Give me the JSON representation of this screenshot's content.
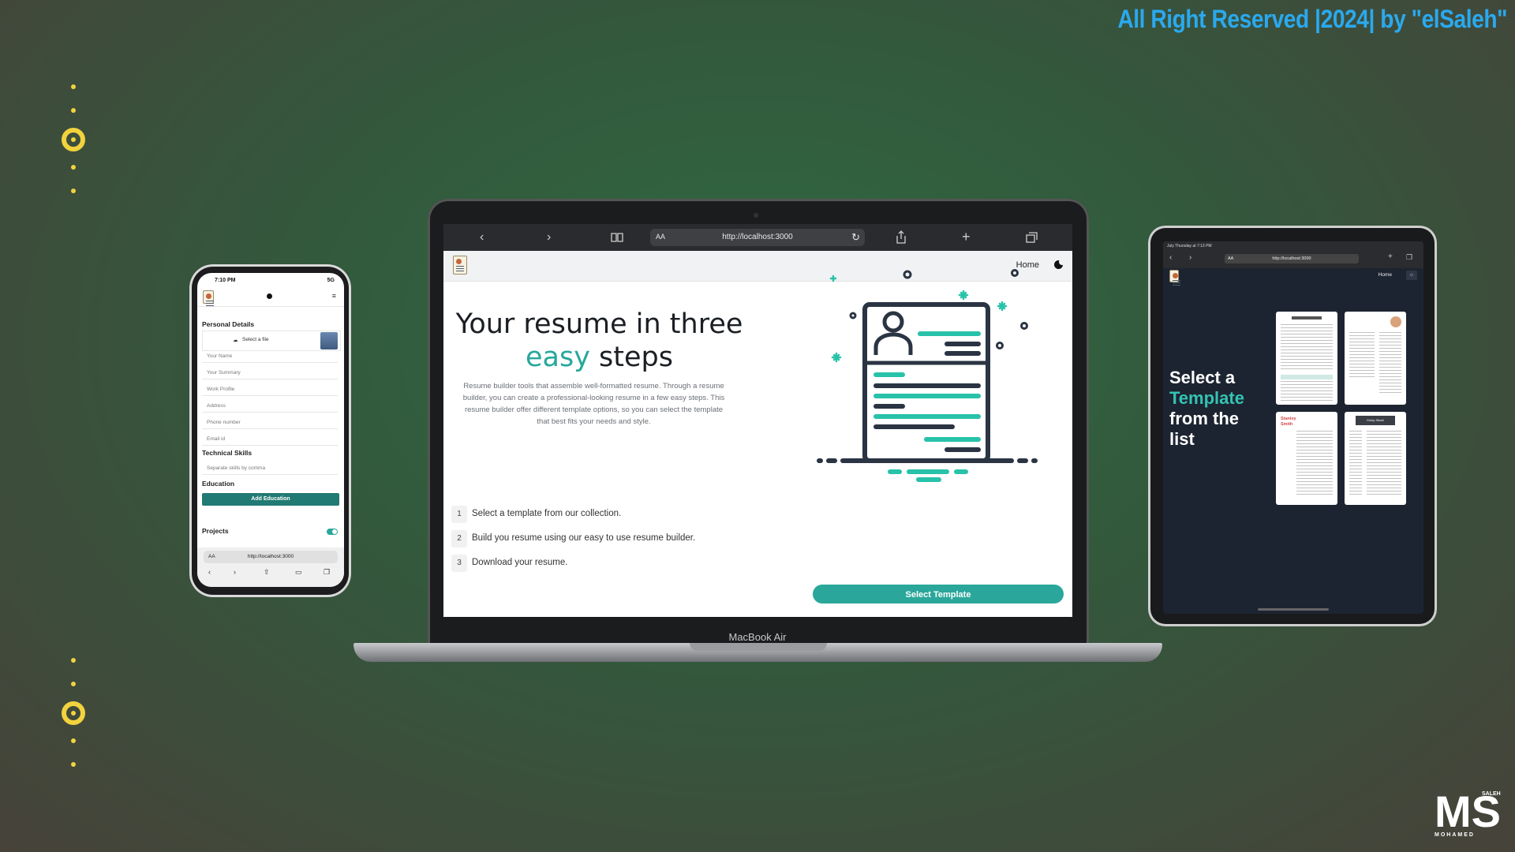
{
  "copyright": "All Right Reserved |2024| by \"elSaleh\"",
  "signature": {
    "letters": "MS",
    "top": "SALEH",
    "bottom": "MOHAMED"
  },
  "laptop": {
    "device_label": "MacBook Air",
    "browser": {
      "aa": "AA",
      "url": "http://localhost:3000"
    },
    "nav": {
      "home": "Home"
    },
    "hero": {
      "title_line1": "Your resume in three",
      "title_accent": "easy",
      "title_rest": " steps",
      "description": "Resume builder tools that assemble well-formatted resume. Through a resume builder, you can create a professional-looking resume in a few easy steps. This resume builder offer different template options, so you can select the template that best fits your needs and style.",
      "steps": [
        {
          "num": "1",
          "text": "Select a template from our collection."
        },
        {
          "num": "2",
          "text": "Build you resume using our easy to use resume builder."
        },
        {
          "num": "3",
          "text": "Download your resume."
        }
      ],
      "cta": "Select Template"
    }
  },
  "phone": {
    "time": "7:10 PM",
    "signal": "5G",
    "sections": {
      "personal": "Personal Details",
      "technical": "Technical Skills",
      "education": "Education",
      "projects": "Projects"
    },
    "select_file": "Select a file",
    "fields": [
      "Your Name",
      "Your Summary",
      "Work Profile",
      "Address",
      "Phone number",
      "Email id"
    ],
    "skills_placeholder": "Separate skills by comma",
    "add_education": "Add Education",
    "aa": "AA",
    "url": "http://localhost:3000"
  },
  "tablet": {
    "status": "July Thursday at 7:13 PM",
    "url": "http://localhost:3000",
    "aa": "AA",
    "nav": {
      "home": "Home"
    },
    "title": {
      "l1": "Select a",
      "l2": "Template",
      "l3": "from the",
      "l4": "list"
    },
    "template_names": [
      "Stanley Smith",
      "Kristy Sledd"
    ]
  },
  "colors": {
    "accent": "#2aa79a",
    "copyright": "#2aa9ee",
    "bullets": "#f2d33d"
  }
}
